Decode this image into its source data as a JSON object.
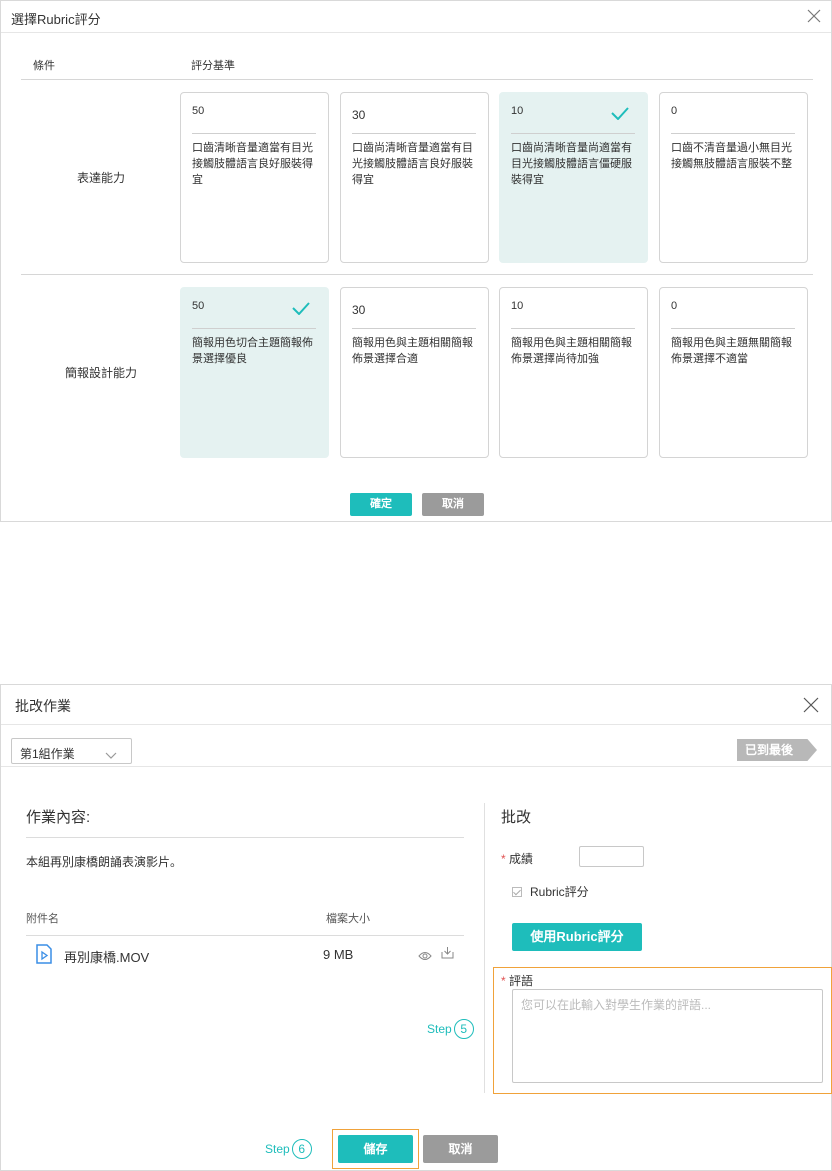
{
  "rubric_dialog": {
    "title": "選擇Rubric評分",
    "col_condition": "條件",
    "col_criteria": "評分基準",
    "rows": [
      {
        "label": "表達能力",
        "levels": [
          {
            "score": "50",
            "desc": "口齒清晰音量適當有目光接觸肢體語言良好服裝得宜",
            "selected": false
          },
          {
            "score": "30",
            "desc": "口齒尚清晰音量適當有目光接觸肢體語言良好服裝得宜",
            "selected": false
          },
          {
            "score": "10",
            "desc": "口齒尚清晰音量尚適當有目光接觸肢體語言僵硬服裝得宜",
            "selected": true
          },
          {
            "score": "0",
            "desc": "口齒不清音量過小無目光接觸無肢體語言服裝不整",
            "selected": false
          }
        ]
      },
      {
        "label": "簡報設計能力",
        "levels": [
          {
            "score": "50",
            "desc": "簡報用色切合主題簡報佈景選擇優良",
            "selected": true
          },
          {
            "score": "30",
            "desc": "簡報用色與主題相關簡報佈景選擇合適",
            "selected": false
          },
          {
            "score": "10",
            "desc": "簡報用色與主題相關簡報佈景選擇尚待加強",
            "selected": false
          },
          {
            "score": "0",
            "desc": "簡報用色與主題無關簡報佈景選擇不適當",
            "selected": false
          }
        ]
      }
    ],
    "confirm_label": "確定",
    "cancel_label": "取消"
  },
  "grade_dialog": {
    "title": "批改作業",
    "group_select": "第1組作業",
    "last_badge": "已到最後",
    "content_heading": "作業內容:",
    "content_desc": "本組再別康橋朗誦表演影片。",
    "attachment_col": "附件名",
    "size_col": "檔案大小",
    "file": {
      "name": "再別康橋.MOV",
      "size": "9 MB"
    },
    "grade_heading": "批改",
    "grade_label": "成績",
    "rubric_check_label": "Rubric評分",
    "use_rubric_button": "使用Rubric評分",
    "comment_label": "評語",
    "comment_placeholder": "您可以在此輸入對學生作業的評語...",
    "required_mark": "*",
    "step5_text": "Step",
    "step5_num": "5",
    "step6_text": "Step",
    "step6_num": "6",
    "save_label": "儲存",
    "cancel_label": "取消"
  },
  "colors": {
    "accent": "#1ebdbb",
    "selected_card": "#e5f2f1",
    "highlight": "#f0a23a",
    "cancel": "#9b9b9b"
  },
  "icons": [
    "close-icon",
    "check-icon",
    "chevron-down-icon",
    "video-file-icon",
    "eye-icon",
    "download-icon"
  ]
}
